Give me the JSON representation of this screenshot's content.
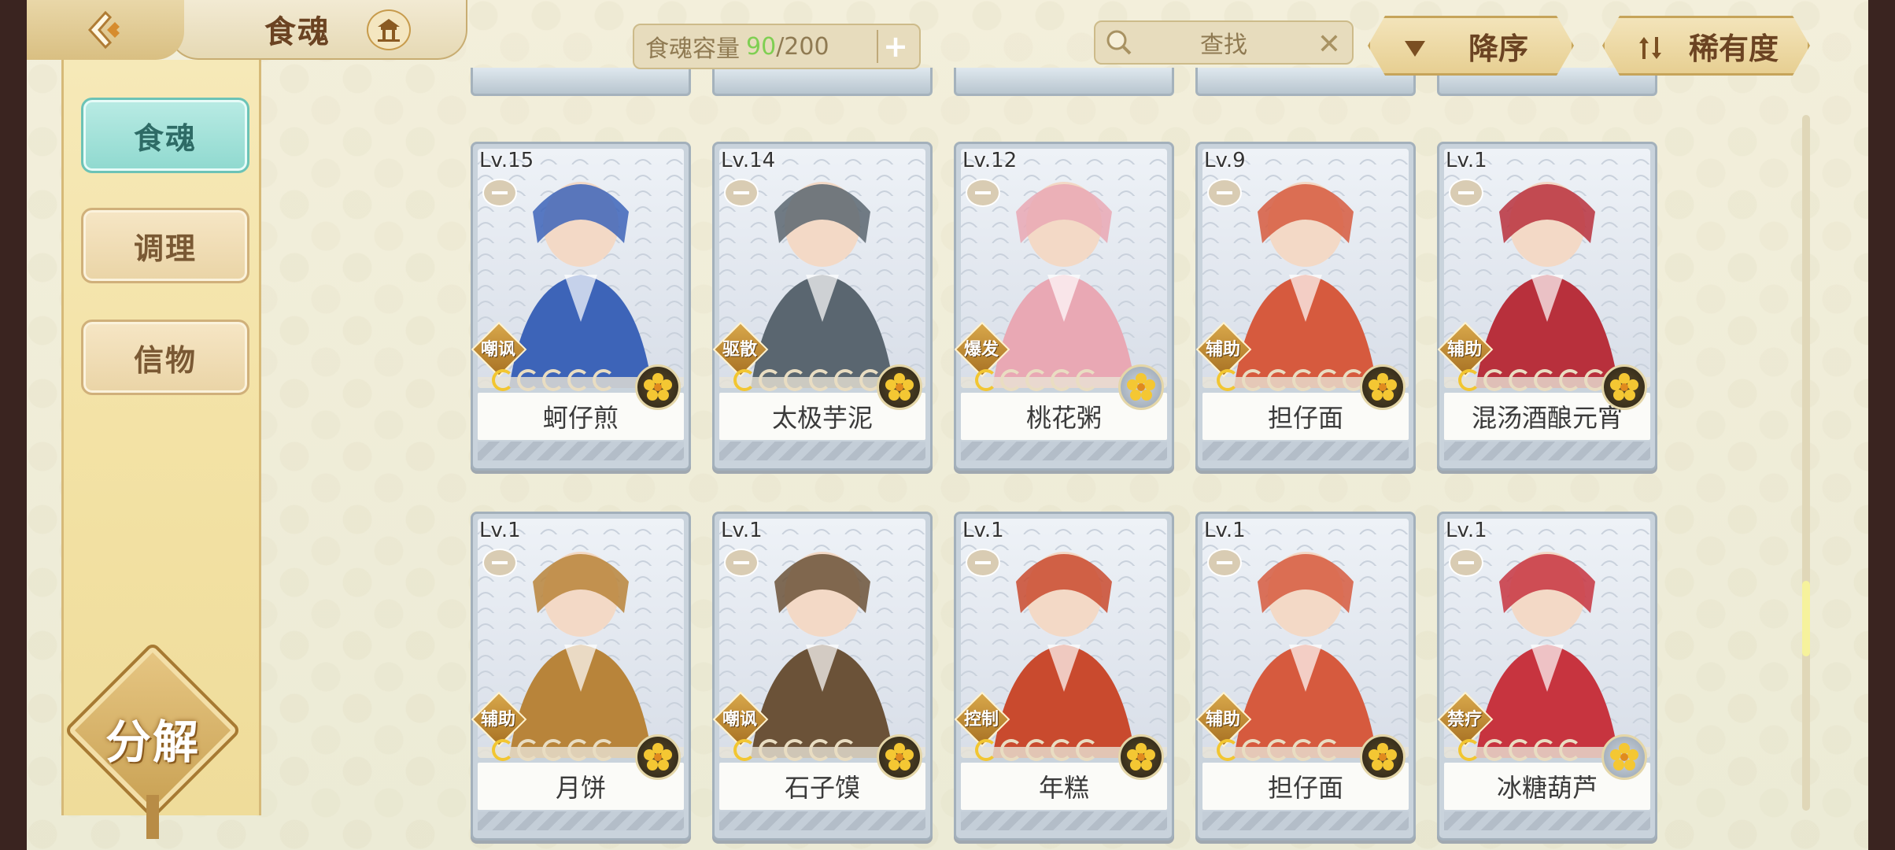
{
  "header": {
    "title": "食魂",
    "capacity": {
      "label": "食魂容量",
      "current": "90",
      "separator": "/",
      "max": "200"
    },
    "search": {
      "label": "查找"
    },
    "sort_order_label": "降序",
    "sort_by_label": "稀有度"
  },
  "sidebar": {
    "items": [
      {
        "label": "食魂",
        "active": true
      },
      {
        "label": "调理",
        "active": false
      },
      {
        "label": "信物",
        "active": false
      }
    ],
    "decompose_label": "分解"
  },
  "colors": {
    "accent_teal": "#8fd9cf",
    "capacity_current": "#7fcf52",
    "gold": "#f2c631"
  },
  "cards": [
    {
      "level": "Lv.15",
      "role": "嘲讽",
      "name": "蚵仔煎",
      "stars_on": 1,
      "stars_total": 5,
      "theme": "#3d64b8"
    },
    {
      "level": "Lv.14",
      "role": "驱散",
      "name": "太极芋泥",
      "stars_on": 1,
      "stars_total": 6,
      "theme": "#5a6670"
    },
    {
      "level": "Lv.12",
      "role": "爆发",
      "name": "桃花粥",
      "stars_on": 1,
      "stars_total": 5,
      "theme": "#e9a8b4"
    },
    {
      "level": "Lv.9",
      "role": "辅助",
      "name": "担仔面",
      "stars_on": 1,
      "stars_total": 6,
      "theme": "#d65a3e"
    },
    {
      "level": "Lv.1",
      "role": "辅助",
      "name": "混汤酒酿元宵",
      "stars_on": 1,
      "stars_total": 6,
      "theme": "#b8303c"
    },
    {
      "level": "Lv.1",
      "role": "辅助",
      "name": "月饼",
      "stars_on": 1,
      "stars_total": 5,
      "theme": "#b8843a"
    },
    {
      "level": "Lv.1",
      "role": "嘲讽",
      "name": "石子馍",
      "stars_on": 1,
      "stars_total": 5,
      "theme": "#6b5238"
    },
    {
      "level": "Lv.1",
      "role": "控制",
      "name": "年糕",
      "stars_on": 1,
      "stars_total": 5,
      "theme": "#c94a2e"
    },
    {
      "level": "Lv.1",
      "role": "辅助",
      "name": "担仔面",
      "stars_on": 1,
      "stars_total": 5,
      "theme": "#d65a3e"
    },
    {
      "level": "Lv.1",
      "role": "禁疗",
      "name": "冰糖葫芦",
      "stars_on": 1,
      "stars_total": 5,
      "theme": "#c7343f"
    }
  ],
  "scroll": {
    "position_fraction": 0.72
  }
}
